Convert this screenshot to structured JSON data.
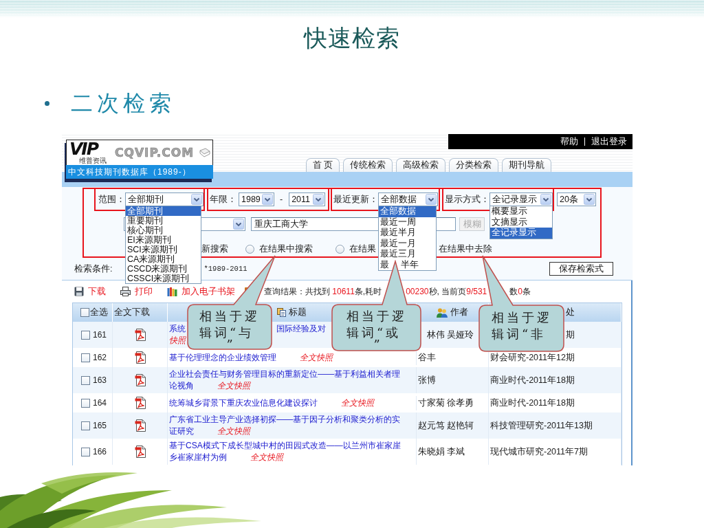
{
  "slide": {
    "title": "快速检索",
    "bullet": "二次检索"
  },
  "site_header": {
    "links": [
      "帮助",
      "退出登录"
    ],
    "logo": {
      "mark": "VIP",
      "tagline": "维普资讯",
      "domain": "CQVIP.COM",
      "database": "中文科技期刊数据库（1989-）"
    },
    "tabs": [
      {
        "label": "首 页",
        "selected": false
      },
      {
        "label": "传统检索",
        "selected": false
      },
      {
        "label": "高级检索",
        "selected": false
      },
      {
        "label": "分类检索",
        "selected": false
      },
      {
        "label": "期刊导航",
        "selected": false
      }
    ]
  },
  "search_form": {
    "scope": {
      "label": "范围：",
      "value": "全部期刊",
      "options": [
        {
          "label": "全部期刊",
          "selected": true
        },
        {
          "label": "重要期刊",
          "selected": false
        },
        {
          "label": "核心期刊",
          "selected": false
        },
        {
          "label": "EI来源期刊",
          "selected": false
        },
        {
          "label": "SCI来源期刊",
          "selected": false
        },
        {
          "label": "CA来源期刊",
          "selected": false
        },
        {
          "label": "CSCD来源期刊",
          "selected": false
        },
        {
          "label": "CSSCI来源期刊",
          "selected": false
        }
      ]
    },
    "years": {
      "label": "年限：",
      "from": "1989",
      "separator": "-",
      "to": "2011"
    },
    "updated": {
      "label": "最近更新：",
      "value": "全部数据",
      "options": [
        {
          "label": "全部数据",
          "selected": true
        },
        {
          "label": "最近一周",
          "selected": false
        },
        {
          "label": "最近半月",
          "selected": false
        },
        {
          "label": "最近一月",
          "selected": false
        },
        {
          "label": "最近三月",
          "selected": false
        },
        {
          "label": "最",
          "tail": "半年",
          "selected": false
        }
      ]
    },
    "display": {
      "label": "显示方式：",
      "value": "全记录显示",
      "options": [
        {
          "label": "概要显示",
          "selected": false
        },
        {
          "label": "文摘显示",
          "selected": false
        },
        {
          "label": "全记录显示",
          "selected": true
        }
      ]
    },
    "page_size": {
      "value": "20条"
    },
    "keyword": {
      "value": "重庆工商大学"
    },
    "match_button": {
      "label": "模糊",
      "disabled": true
    },
    "modes": [
      {
        "kind": "label",
        "label": "新搜索"
      },
      {
        "kind": "radio",
        "label": "在结果中搜索",
        "selected": false
      },
      {
        "kind": "radio",
        "label": "在结果",
        "selected": false
      },
      {
        "kind": "label",
        "label": "在结果中去除"
      }
    ],
    "conditions": {
      "label": "检索条件:",
      "value": "*1989-2011"
    },
    "save_button": {
      "label": "保存检索式"
    }
  },
  "toolbar": {
    "actions": [
      {
        "kind": "download",
        "label": "下载"
      },
      {
        "kind": "print",
        "label": "打印"
      },
      {
        "kind": "shelf",
        "label": "加入电子书架"
      }
    ],
    "summary": [
      {
        "segments": [
          {
            "kind": "text",
            "text": "查询结果：共找到 "
          },
          {
            "kind": "number",
            "text": "10611"
          },
          {
            "kind": "text",
            "text": "条,耗时"
          }
        ]
      },
      {
        "segments": [
          {
            "kind": "number",
            "text": "00230"
          },
          {
            "kind": "text",
            "text": "秒, 当前页"
          },
          {
            "kind": "number",
            "text": "9/531"
          }
        ]
      },
      {
        "segments": [
          {
            "kind": "text",
            "text": "数"
          },
          {
            "kind": "number",
            "text": "0"
          },
          {
            "kind": "text",
            "text": "条"
          }
        ]
      }
    ]
  },
  "table": {
    "columns": [
      {
        "kind": "select_all",
        "label": "全选",
        "checked": false
      },
      {
        "kind": "download",
        "label": "全文下载"
      },
      {
        "kind": "title",
        "label": "标题"
      },
      {
        "kind": "author",
        "label": "作者"
      },
      {
        "kind": "source",
        "label": "处"
      }
    ],
    "rows": [
      {
        "number": "161",
        "checked": false,
        "title_lines": [
          {
            "fragments": [
              "系统",
              "国际经验及对"
            ]
          },
          {
            "snapshot_tail": "快照"
          }
        ],
        "authors_tail": "林伟 吴娅玲",
        "source_tail": "期"
      },
      {
        "number": "162",
        "checked": false,
        "title_lines": [
          {
            "text": "基于伦理理念的企业绩效管理",
            "snapshot": "全文快照"
          }
        ],
        "authors": "谷丰",
        "source": "财会研究-2011年12期"
      },
      {
        "number": "163",
        "checked": false,
        "title_lines": [
          {
            "text": "企业社会责任与财务管理目标的重新定位——基于利益相关者理"
          },
          {
            "text": "论视角",
            "snapshot": "全文快照"
          }
        ],
        "authors": "张博",
        "source": "商业时代-2011年18期"
      },
      {
        "number": "164",
        "checked": false,
        "title_lines": [
          {
            "text": "统筹城乡背景下重庆农业信息化建设探讨",
            "snapshot": "全文快照"
          }
        ],
        "authors": "寸家菊 徐孝勇",
        "source": "商业时代-2011年18期"
      },
      {
        "number": "165",
        "checked": false,
        "title_lines": [
          {
            "text": "广东省工业主导产业选择初探——基于因子分析和聚类分析的实"
          },
          {
            "text": "证研究",
            "snapshot": "全文快照"
          }
        ],
        "authors": "赵元笃 赵艳轲",
        "source": "科技管理研究-2011年13期"
      },
      {
        "number": "166",
        "checked": false,
        "title_lines": [
          {
            "text": "基于CSA模式下成长型城中村的田园式改造——以兰州市崔家崖"
          },
          {
            "text": "乡崔家崖村为例",
            "snapshot": "全文快照"
          }
        ],
        "authors": "朱晓娟 李斌",
        "source": "现代城市研究-2011年7期"
      }
    ]
  },
  "callouts": [
    {
      "text": "相当于逻辑词“与”"
    },
    {
      "text": "相当于逻辑词“或”"
    },
    {
      "text": "相当于逻辑词“非"
    }
  ]
}
